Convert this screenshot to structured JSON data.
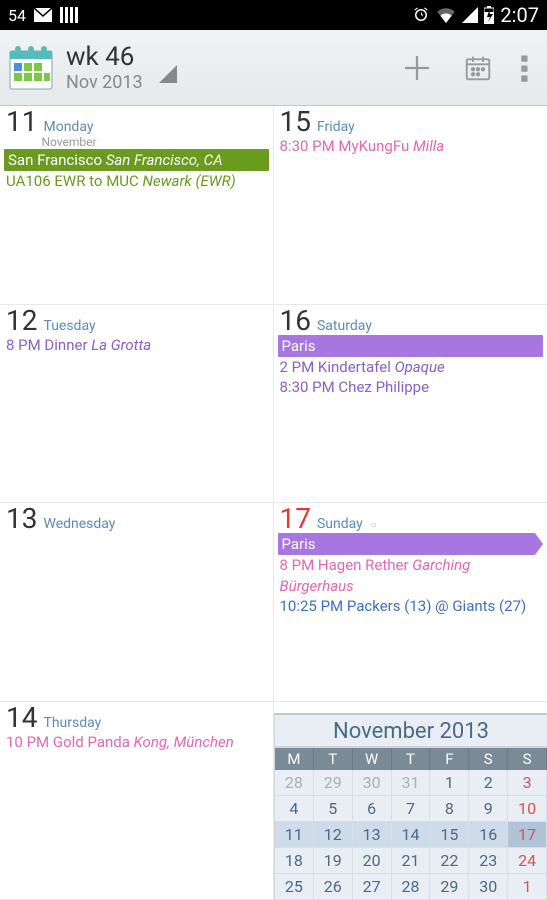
{
  "status": {
    "left_num": "54",
    "time": "2:07"
  },
  "header": {
    "week": "wk 46",
    "month": "Nov 2013"
  },
  "days": [
    {
      "num": "11",
      "name": "Monday",
      "sub": "November",
      "today": false,
      "events": [
        {
          "type": "allday",
          "color": "#6a9a1e",
          "text": "San Francisco",
          "loc": "San Francisco, CA"
        },
        {
          "type": "timed",
          "color": "#6a9a1e",
          "text": "UA106 EWR to MUC",
          "loc": "Newark (EWR)"
        }
      ]
    },
    {
      "num": "15",
      "name": "Friday",
      "today": false,
      "events": [
        {
          "type": "timed",
          "color": "#e267b3",
          "text": "8:30 PM MyKungFu",
          "loc": "Milla"
        }
      ]
    },
    {
      "num": "12",
      "name": "Tuesday",
      "today": false,
      "events": [
        {
          "type": "timed",
          "color": "#8a5fc7",
          "text": "8 PM Dinner",
          "loc": "La Grotta"
        }
      ]
    },
    {
      "num": "16",
      "name": "Saturday",
      "today": false,
      "events": [
        {
          "type": "allday",
          "color": "#a876e0",
          "text": "Paris",
          "loc": ""
        },
        {
          "type": "timed",
          "color": "#8a5fc7",
          "text": "2 PM Kindertafel",
          "loc": "Opaque"
        },
        {
          "type": "timed",
          "color": "#8a5fc7",
          "text": "8:30 PM Chez Philippe",
          "loc": ""
        }
      ]
    },
    {
      "num": "13",
      "name": "Wednesday",
      "today": false,
      "events": []
    },
    {
      "num": "17",
      "name": "Sunday",
      "today": true,
      "holiday": true,
      "events": [
        {
          "type": "allday",
          "color": "#a876e0",
          "text": "Paris",
          "loc": "",
          "arrow": true
        },
        {
          "type": "timed",
          "color": "#e267b3",
          "text": "8 PM Hagen Rether",
          "loc": "Garching Bürgerhaus",
          "wrap": true
        },
        {
          "type": "timed",
          "color": "#3a6fc7",
          "text": "10:25 PM Packers (13) @ Giants (27)",
          "loc": ""
        }
      ]
    },
    {
      "num": "14",
      "name": "Thursday",
      "today": false,
      "events": [
        {
          "type": "timed",
          "color": "#e267b3",
          "text": "10 PM Gold Panda",
          "loc": "Kong, München"
        }
      ]
    },
    {
      "num": "",
      "name": "",
      "events": []
    }
  ],
  "mini": {
    "title": "November 2013",
    "heads": [
      "M",
      "T",
      "W",
      "T",
      "F",
      "S",
      "S"
    ],
    "rows": [
      [
        {
          "d": "28",
          "o": true
        },
        {
          "d": "29",
          "o": true
        },
        {
          "d": "30",
          "o": true
        },
        {
          "d": "31",
          "o": true
        },
        {
          "d": "1"
        },
        {
          "d": "2"
        },
        {
          "d": "3",
          "s": true
        }
      ],
      [
        {
          "d": "4"
        },
        {
          "d": "5"
        },
        {
          "d": "6"
        },
        {
          "d": "7"
        },
        {
          "d": "8"
        },
        {
          "d": "9"
        },
        {
          "d": "10",
          "s": true
        }
      ],
      [
        {
          "d": "11"
        },
        {
          "d": "12"
        },
        {
          "d": "13"
        },
        {
          "d": "14"
        },
        {
          "d": "15"
        },
        {
          "d": "16"
        },
        {
          "d": "17",
          "s": true,
          "t": true
        }
      ],
      [
        {
          "d": "18"
        },
        {
          "d": "19"
        },
        {
          "d": "20"
        },
        {
          "d": "21"
        },
        {
          "d": "22"
        },
        {
          "d": "23"
        },
        {
          "d": "24",
          "s": true
        }
      ],
      [
        {
          "d": "25"
        },
        {
          "d": "26"
        },
        {
          "d": "27"
        },
        {
          "d": "28"
        },
        {
          "d": "29"
        },
        {
          "d": "30"
        },
        {
          "d": "1",
          "o": true,
          "s": true
        }
      ]
    ]
  }
}
